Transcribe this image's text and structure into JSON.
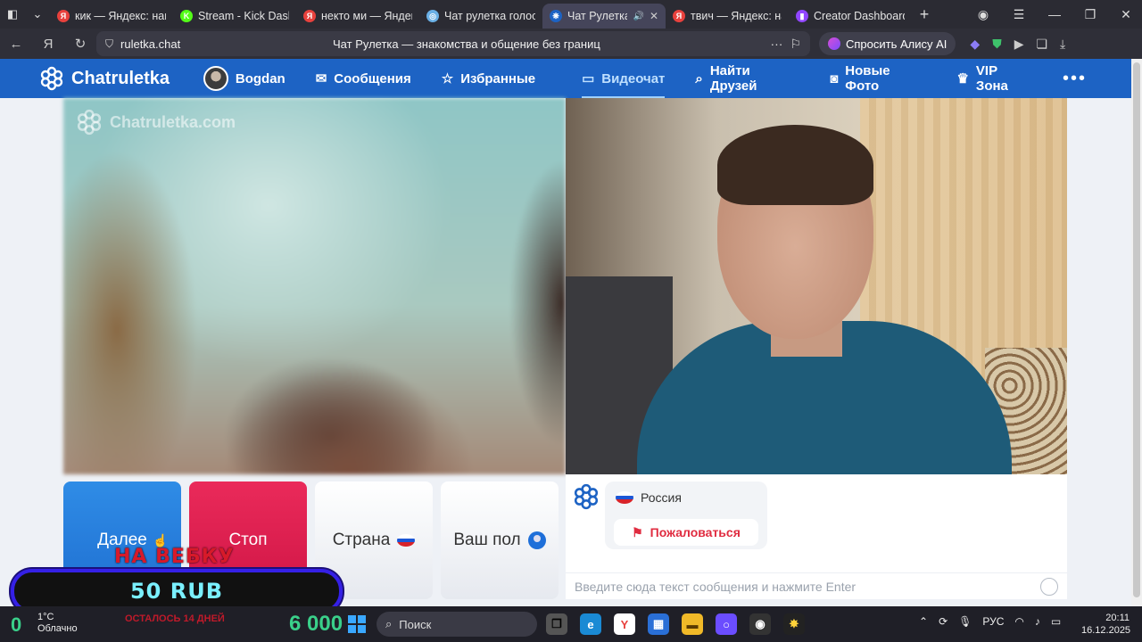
{
  "browser": {
    "tabs": [
      {
        "title": "кик — Яндекс: наш",
        "favicon": "yandex-icon",
        "color": "#e8413d",
        "letter": "Я"
      },
      {
        "title": "Stream - Kick Dashb",
        "favicon": "kick-icon",
        "color": "#53fc18",
        "letter": "K"
      },
      {
        "title": "некто ми — Яндекс",
        "favicon": "yandex-icon",
        "color": "#e8413d",
        "letter": "Я"
      },
      {
        "title": "Чат рулетка голосо",
        "favicon": "chat-icon",
        "color": "#6ab0e6",
        "letter": "◎"
      },
      {
        "title": "Чат Рулетка —",
        "favicon": "chatruletka-icon",
        "color": "#1d63c4",
        "letter": "❋",
        "active": true
      },
      {
        "title": "твич — Яндекс: наш",
        "favicon": "yandex-icon",
        "color": "#e8413d",
        "letter": "Я"
      },
      {
        "title": "Creator Dashboard",
        "favicon": "twitch-icon",
        "color": "#9146ff",
        "letter": "▮"
      }
    ],
    "url": "ruletka.chat",
    "page_title": "Чат Рулетка — знакомства и общение без границ",
    "alice_label": "Спросить Алису AI"
  },
  "site": {
    "brand": "Chatruletka",
    "user": "Bogdan",
    "nav": [
      {
        "label": "Сообщения",
        "icon": "envelope-icon"
      },
      {
        "label": "Избранные",
        "icon": "star-icon"
      },
      {
        "label": "Видеочат",
        "icon": "video-camera-icon",
        "active": true
      },
      {
        "label": "Найти Друзей",
        "icon": "search-icon"
      },
      {
        "label": "Новые Фото",
        "icon": "camera-icon"
      },
      {
        "label": "VIP Зона",
        "icon": "crown-icon"
      }
    ],
    "watermark": "Chatruletka.com",
    "accent": "#1d63c4"
  },
  "controls": {
    "next": "Далее",
    "stop": "Стоп",
    "country": "Страна",
    "gender": "Ваш пол"
  },
  "chat": {
    "partner_country": "Россия",
    "report": "Пожаловаться",
    "input_placeholder": "Введите сюда текст сообщения и нажмите Enter"
  },
  "overlay": {
    "title": "НА ВЕБКУ",
    "amount": "50 RUB",
    "subtitle": "ОСТАЛОСЬ 14 ДНЕЙ"
  },
  "taskbar": {
    "zero": "0",
    "temperature": "1°C",
    "weather": "Облачно",
    "counter": "6 000",
    "search_label": "Поиск",
    "language": "РУС",
    "time": "20:11",
    "date": "16.12.2025"
  }
}
